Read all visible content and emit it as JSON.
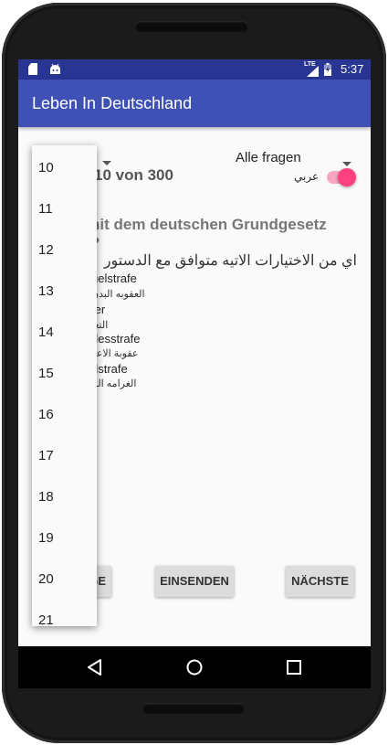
{
  "status_bar": {
    "time": "5:37",
    "network": "LTE",
    "left_icons": [
      "sd-card-icon",
      "android-icon"
    ],
    "right_icons": [
      "signal-icon",
      "battery-icon"
    ]
  },
  "app_bar": {
    "title": "Leben In Deutschland"
  },
  "filter": {
    "category_selected": "Alle fragen",
    "question_counter_visible": "10 von 300",
    "language_toggle_label": "عربي",
    "language_toggle_on": true
  },
  "question": {
    "german_visible_line1": "hit dem deutschen Grundgesetz",
    "german_visible_line2": "?",
    "arabic": "اي من الاختيارات الاتيه متوافق مع الدستور الا"
  },
  "answers": [
    {
      "german": "gelstrafe",
      "arabic": "العقوبه البدن"
    },
    {
      "german": "ter",
      "arabic": "التعـ"
    },
    {
      "german": "desstrafe",
      "arabic": "عقوبة الاعد"
    },
    {
      "german": "dstrafe",
      "arabic": "الغرامه الم"
    }
  ],
  "buttons": {
    "previous_visible": "GE",
    "submit": "EINSENDEN",
    "next": "NÄCHSTE"
  },
  "question_number_dropdown": {
    "items": [
      "10",
      "11",
      "12",
      "13",
      "14",
      "15",
      "16",
      "17",
      "18",
      "19",
      "20",
      "21"
    ]
  },
  "colors": {
    "status_bar": "#283593",
    "app_bar": "#3f51b5",
    "toggle_accent": "#ff4081",
    "background": "#fafafa"
  }
}
